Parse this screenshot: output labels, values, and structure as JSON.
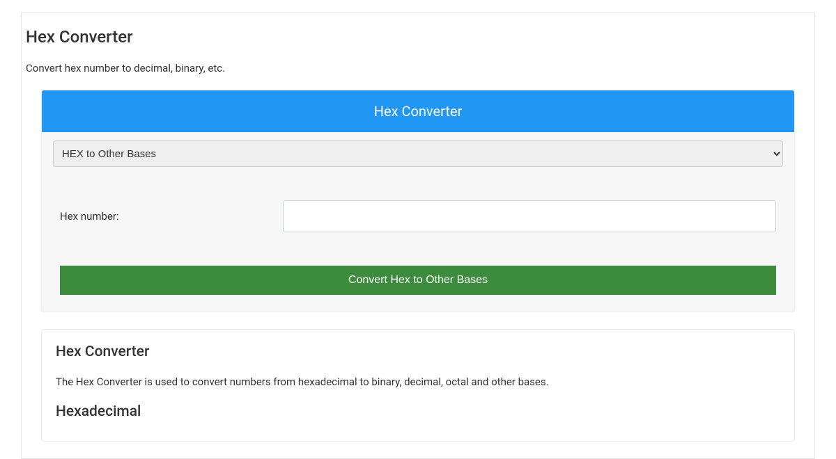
{
  "page": {
    "title": "Hex Converter",
    "subtitle": "Convert hex number to decimal, binary, etc."
  },
  "converter": {
    "panel_title": "Hex Converter",
    "select_value": "HEX to Other Bases",
    "input_label": "Hex number:",
    "input_value": "",
    "input_placeholder": "",
    "button_label": "Convert Hex to Other Bases"
  },
  "info": {
    "title": "Hex Converter",
    "description": "The Hex Converter is used to convert numbers from hexadecimal to binary, decimal, octal and other bases.",
    "subtitle": "Hexadecimal"
  },
  "colors": {
    "header_bg": "#2196f3",
    "button_bg": "#3d8b3d"
  }
}
